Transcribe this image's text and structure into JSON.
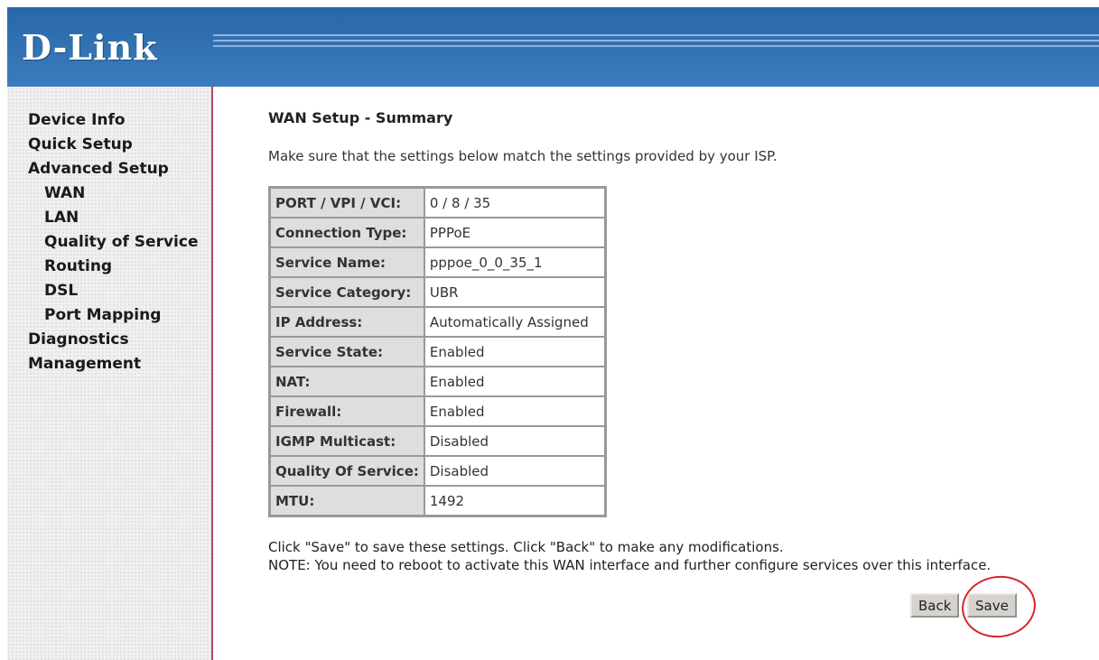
{
  "brand": {
    "logo": "D-Link"
  },
  "sidebar": {
    "items": [
      {
        "label": "Device Info"
      },
      {
        "label": "Quick Setup"
      },
      {
        "label": "Advanced Setup"
      },
      {
        "label": "WAN"
      },
      {
        "label": "LAN"
      },
      {
        "label": "Quality of Service"
      },
      {
        "label": "Routing"
      },
      {
        "label": "DSL"
      },
      {
        "label": "Port Mapping"
      },
      {
        "label": "Diagnostics"
      },
      {
        "label": "Management"
      }
    ]
  },
  "main": {
    "title": "WAN Setup - Summary",
    "intro": "Make sure that the settings below match the settings provided by your ISP.",
    "summary": [
      {
        "key": "PORT / VPI / VCI:",
        "value": "0 / 8 / 35"
      },
      {
        "key": "Connection Type:",
        "value": "PPPoE"
      },
      {
        "key": "Service Name:",
        "value": "pppoe_0_0_35_1"
      },
      {
        "key": "Service Category:",
        "value": "UBR"
      },
      {
        "key": "IP Address:",
        "value": "Automatically Assigned"
      },
      {
        "key": "Service State:",
        "value": "Enabled"
      },
      {
        "key": "NAT:",
        "value": "Enabled"
      },
      {
        "key": "Firewall:",
        "value": "Enabled"
      },
      {
        "key": "IGMP Multicast:",
        "value": "Disabled"
      },
      {
        "key": "Quality Of Service:",
        "value": "Disabled"
      },
      {
        "key": "MTU:",
        "value": "1492"
      }
    ],
    "footer_line1": "Click \"Save\" to save these settings. Click \"Back\" to make any modifications.",
    "footer_line2": "NOTE: You need to reboot to activate this WAN interface and further configure services over this interface.",
    "back_label": "Back",
    "save_label": "Save"
  },
  "colors": {
    "header": "#2f6fb2",
    "sidebar_border": "#b5485a",
    "highlight_circle": "#d4252b"
  }
}
